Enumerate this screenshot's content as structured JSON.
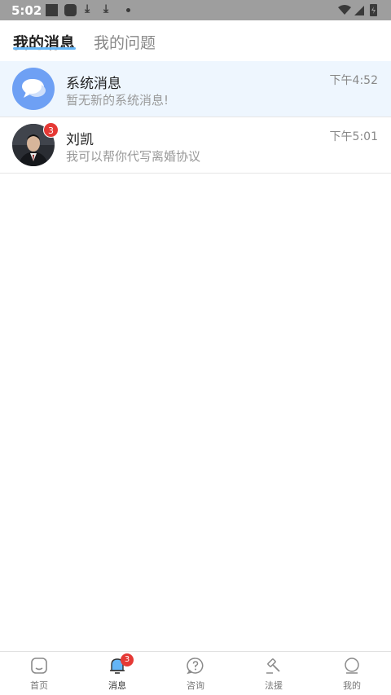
{
  "status_bar": {
    "time": "5:02"
  },
  "header": {
    "tabs": [
      {
        "label": "我的消息"
      },
      {
        "label": "我的问题"
      }
    ]
  },
  "messages": [
    {
      "name": "系统消息",
      "preview": "暂无新的系统消息!",
      "time": "下午4:52"
    },
    {
      "name": "刘凯",
      "preview": "我可以帮你代写离婚协议",
      "time": "下午5:01",
      "badge": "3"
    }
  ],
  "bottom_nav": [
    {
      "label": "首页"
    },
    {
      "label": "消息",
      "badge": "3"
    },
    {
      "label": "咨询"
    },
    {
      "label": "法援"
    },
    {
      "label": "我的"
    }
  ],
  "colors": {
    "accent": "#64b5f6",
    "badge": "#e53935",
    "highlight_row": "#eef6fe"
  }
}
